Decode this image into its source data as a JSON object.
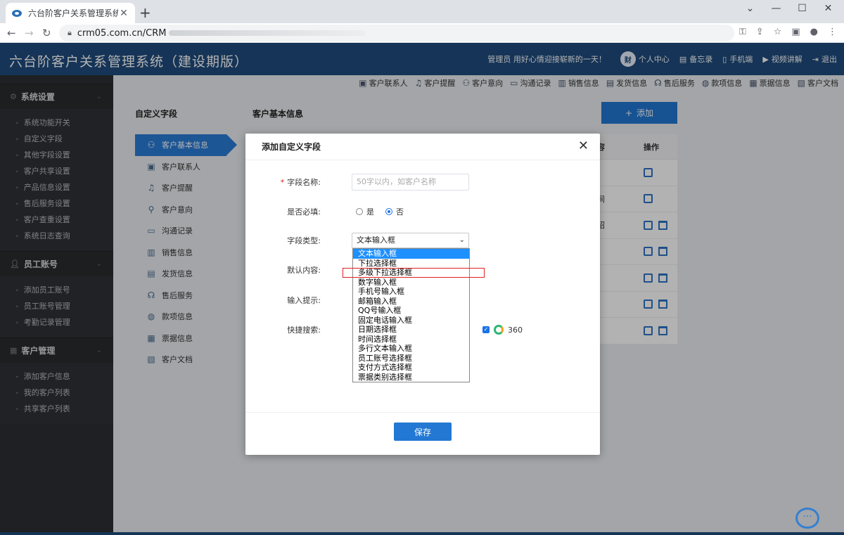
{
  "browser": {
    "tab_title": "六台阶客户关系管理系统（建设期",
    "tab_close": "✕",
    "new_tab": "+",
    "url": "crm05.com.cn/CRM",
    "window_controls": [
      "⌄",
      "—",
      "☐",
      "✕"
    ]
  },
  "header": {
    "title": "六台阶客户关系管理系统（建设期版）",
    "welcome": "管理员 用好心情迎接崭新的一天！",
    "avatar_text": "财",
    "items": [
      "个人中心",
      "备忘录",
      "手机端",
      "视频讲解",
      "退出"
    ]
  },
  "sidebar": {
    "groups": [
      {
        "title": "系统设置",
        "items": [
          "系统功能开关",
          "自定义字段",
          "其他字段设置",
          "客户共享设置",
          "产品信息设置",
          "售后服务设置",
          "客户查重设置",
          "系统日志查询"
        ]
      },
      {
        "title": "员工账号",
        "items": [
          "添加员工账号",
          "员工账号管理",
          "考勤记录管理"
        ]
      },
      {
        "title": "客户管理",
        "items": [
          "添加客户信息",
          "我的客户列表",
          "共享客户列表"
        ]
      }
    ]
  },
  "quicknav": [
    "客户联系人",
    "客户提醒",
    "客户意向",
    "沟通记录",
    "销售信息",
    "发货信息",
    "售后服务",
    "款项信息",
    "票据信息",
    "客户文档"
  ],
  "panel": {
    "left_title": "自定义字段",
    "right_title": "客户基本信息",
    "add_button": "添加",
    "categories": [
      "客户基本信息",
      "客户联系人",
      "客户提醒",
      "客户意向",
      "沟通记录",
      "销售信息",
      "发货信息",
      "售后服务",
      "款项信息",
      "票据信息",
      "客户文档"
    ],
    "table": {
      "col_frag_header": "容",
      "op_header": "操作",
      "rows": [
        {
          "frag": "",
          "delete": false
        },
        {
          "frag": "间",
          "delete": false
        },
        {
          "frag": "绍",
          "delete": true
        },
        {
          "frag": "",
          "delete": true
        },
        {
          "frag": "",
          "delete": true
        },
        {
          "frag": "",
          "delete": true
        },
        {
          "frag": "",
          "delete": true
        }
      ]
    }
  },
  "modal": {
    "title": "添加自定义字段",
    "close": "✕",
    "field_name_label": "字段名称:",
    "field_name_placeholder": "50字以内，如客户名称",
    "required_label": "是否必填:",
    "yes": "是",
    "no": "否",
    "required_value": "否",
    "type_label": "字段类型:",
    "type_selected": "文本输入框",
    "default_label": "默认内容:",
    "hint_label": "输入提示:",
    "quick_search_label": "快捷搜索:",
    "quick_search_engine": "360",
    "save": "保存",
    "type_options": [
      "文本输入框",
      "下拉选择框",
      "多级下拉选择框",
      "数字输入框",
      "手机号输入框",
      "邮箱输入框",
      "QQ号输入框",
      "固定电话输入框",
      "日期选择框",
      "时间选择框",
      "多行文本输入框",
      "员工账号选择框",
      "支付方式选择框",
      "票据类别选择框"
    ],
    "highlighted_option": "多级下拉选择框"
  },
  "colors": {
    "header_bg": "#1f4b7d",
    "accent": "#2278d3",
    "sidebar_bg": "#2c2f33",
    "highlight_box": "#e02020"
  }
}
